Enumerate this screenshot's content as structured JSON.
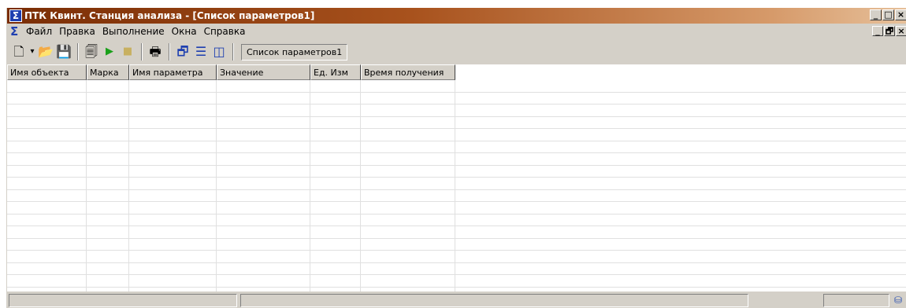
{
  "window": {
    "title": "ПТК Квинт. Станция анализа - [Список параметров1]",
    "app_icon": "sigma-icon",
    "controls": [
      "_",
      "□",
      "×"
    ],
    "mdi_controls": [
      "_",
      "🗗",
      "×"
    ]
  },
  "menu": {
    "icon": "sigma-icon",
    "items": [
      "Файл",
      "Правка",
      "Выполнение",
      "Окна",
      "Справка"
    ]
  },
  "toolbar": {
    "buttons": [
      {
        "name": "new-document-icon",
        "glyph": "🗋"
      },
      {
        "name": "dropdown-arrow-icon",
        "glyph": "▾"
      },
      {
        "name": "open-folder-icon",
        "glyph": "📂"
      },
      {
        "name": "save-icon",
        "glyph": "💾"
      },
      {
        "name": "properties-icon",
        "glyph": "🗐"
      },
      {
        "name": "run-icon",
        "glyph": "▶"
      },
      {
        "name": "stop-icon",
        "glyph": "■"
      },
      {
        "name": "print-icon",
        "glyph": "🖶"
      },
      {
        "name": "cascade-windows-icon",
        "glyph": "🗗"
      },
      {
        "name": "tile-horizontal-icon",
        "glyph": "☰"
      },
      {
        "name": "tile-vertical-icon",
        "glyph": "◫"
      }
    ],
    "doc_tab": "Список параметров1"
  },
  "table": {
    "columns": [
      "Имя объекта",
      "Марка",
      "Имя параметра",
      "Значение",
      "Ед. Изм",
      "Время получения"
    ],
    "rows": []
  },
  "colors": {
    "title_start": "#7a2d05",
    "title_end": "#e6c09a",
    "face": "#d4d0c8",
    "run": "#1aa01a",
    "stop": "#c8b060"
  }
}
